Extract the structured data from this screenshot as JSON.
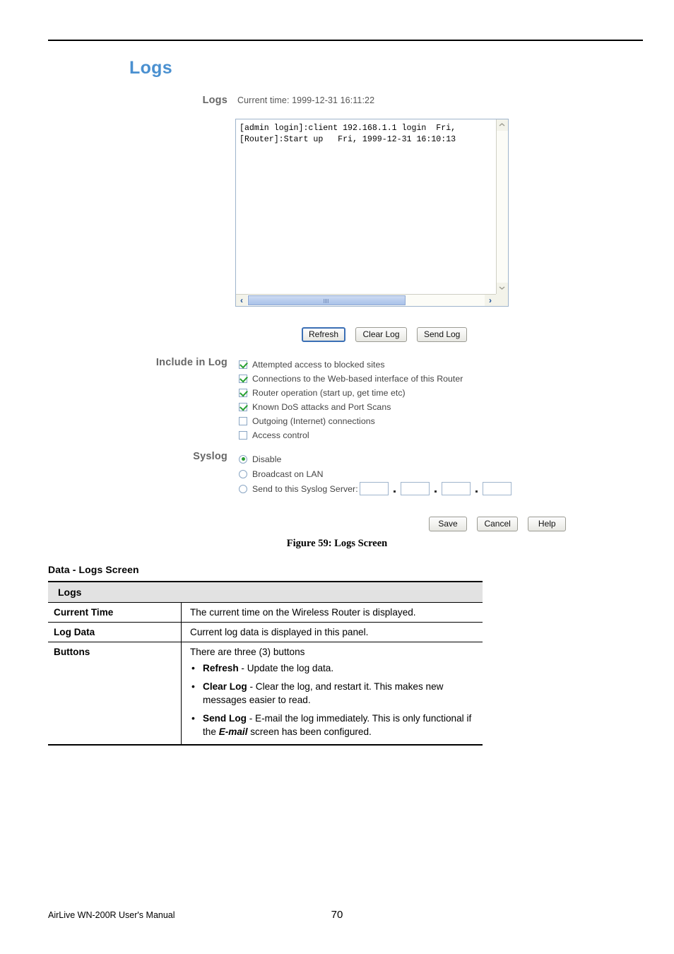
{
  "page": {
    "heading": "Logs",
    "figure_caption": "Figure 59: Logs Screen",
    "data_title": "Data - Logs Screen",
    "footer_manual": "AirLive WN-200R User's Manual",
    "footer_page": "70",
    "accent_color": "#4a90d0"
  },
  "router_ui": {
    "logs_section": {
      "label": "Logs",
      "current_time": "Current time: 1999-12-31 16:11:22",
      "log_text": "[admin login]:client 192.168.1.1 login  Fri,\n[Router]:Start up   Fri, 1999-12-31 16:10:13",
      "scroll_up_icon": "chevron-up-icon",
      "scroll_down_icon": "chevron-down-icon",
      "scroll_left_icon": "‹",
      "scroll_right_icon": "›",
      "buttons": [
        {
          "label": "Refresh",
          "focused": true
        },
        {
          "label": "Clear Log",
          "focused": false
        },
        {
          "label": "Send Log",
          "focused": false
        }
      ]
    },
    "include_in_log": {
      "label": "Include in Log",
      "options": [
        {
          "label": "Attempted access to blocked sites",
          "checked": true
        },
        {
          "label": "Connections to the Web-based interface of this Router",
          "checked": true
        },
        {
          "label": "Router operation (start up, get time etc)",
          "checked": true
        },
        {
          "label": "Known DoS attacks and Port Scans",
          "checked": true
        },
        {
          "label": "Outgoing (Internet) connections",
          "checked": false
        },
        {
          "label": "Access control",
          "checked": false
        }
      ]
    },
    "syslog": {
      "label": "Syslog",
      "options": [
        {
          "label": "Disable",
          "selected": true
        },
        {
          "label": "Broadcast on LAN",
          "selected": false
        },
        {
          "label": "Send to this Syslog Server:",
          "selected": false
        }
      ],
      "server_ip": [
        "",
        "",
        "",
        ""
      ]
    },
    "action_buttons": [
      {
        "label": "Save"
      },
      {
        "label": "Cancel"
      },
      {
        "label": "Help"
      }
    ]
  },
  "data_table": {
    "header": "Logs",
    "rows": [
      {
        "key": "Current Time",
        "value": "The current time on the Wireless Router is displayed."
      },
      {
        "key": "Log Data",
        "value": "Current log data is displayed in this panel."
      },
      {
        "key": "Buttons",
        "intro": "There are three (3) buttons",
        "bullets": [
          {
            "term": "Refresh",
            "text": " - Update the log data."
          },
          {
            "term": "Clear Log",
            "text": " - Clear the log, and restart it. This makes new messages easier to read."
          },
          {
            "term": "Send Log",
            "text_before": " - E-mail the log immediately. This is only functional if the ",
            "emphasis": "E-mail",
            "text_after": " screen has been configured."
          }
        ]
      }
    ]
  }
}
